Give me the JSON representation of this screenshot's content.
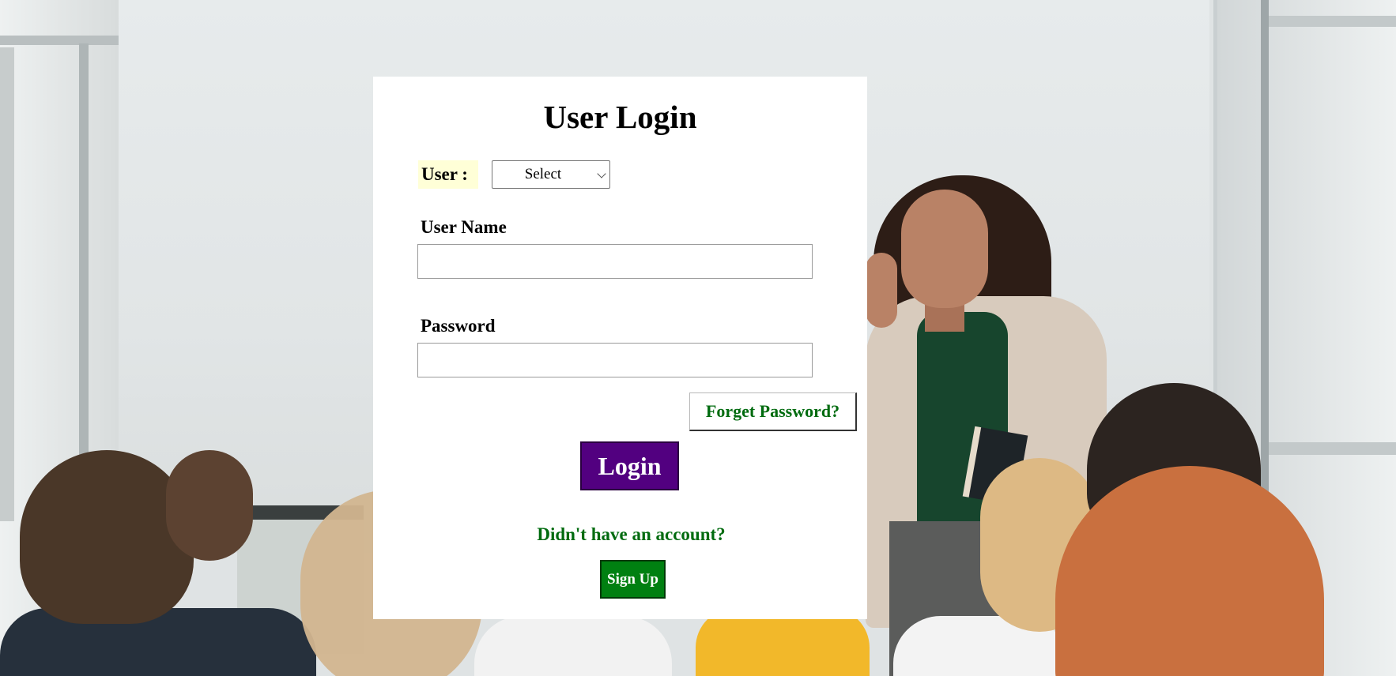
{
  "page": {
    "title": "User Login"
  },
  "user_type": {
    "label": "User :",
    "selected": "Select"
  },
  "username": {
    "label": "User Name",
    "value": "",
    "placeholder": ""
  },
  "password": {
    "label": "Password",
    "value": "",
    "placeholder": ""
  },
  "actions": {
    "forget_password": "Forget Password?",
    "login": "Login",
    "signup_prompt": "Didn't have an account?",
    "signup": "Sign Up"
  },
  "colors": {
    "login_button": "#520080",
    "signup_button": "#008011",
    "link_text": "#006b0f",
    "user_label_bg": "#ffffd7"
  }
}
